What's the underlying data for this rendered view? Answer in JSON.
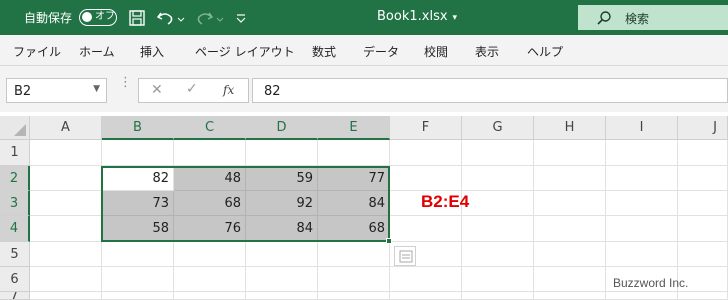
{
  "titlebar": {
    "autosave_label": "自動保存",
    "autosave_state": "オフ",
    "file_name": "Book1.xlsx",
    "search_label": "検索"
  },
  "menu": [
    "ファイル",
    "ホーム",
    "挿入",
    "ページ レイアウト",
    "数式",
    "データ",
    "校閲",
    "表示",
    "ヘルプ"
  ],
  "formula_bar": {
    "name_box": "B2",
    "fx_label": "fx",
    "value": "82"
  },
  "grid": {
    "columns": [
      "A",
      "B",
      "C",
      "D",
      "E",
      "F",
      "G",
      "H",
      "I",
      "J"
    ],
    "rows": [
      "1",
      "2",
      "3",
      "4",
      "5",
      "6",
      "7"
    ],
    "values": {
      "r2": [
        "82",
        "48",
        "59",
        "77"
      ],
      "r3": [
        "73",
        "68",
        "92",
        "84"
      ],
      "r4": [
        "58",
        "76",
        "84",
        "68"
      ]
    }
  },
  "range_label": "B2:E4",
  "watermark": "Buzzword Inc.",
  "colors": {
    "accent": "#217346",
    "range_label": "#e00000",
    "selection_fill": "#c6c6c6"
  }
}
